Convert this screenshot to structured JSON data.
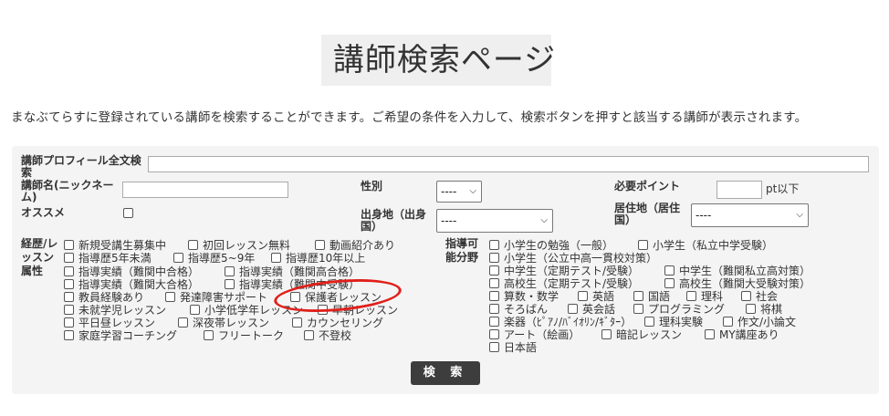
{
  "page": {
    "title": "講師検索ページ",
    "description": "まなぶてらすに登録されている講師を検索することができます。ご希望の条件を入力して、検索ボタンを押すと該当する講師が表示されます。"
  },
  "form": {
    "profile_label": "講師プロフィール全文検索",
    "name_label": "講師名(ニックネーム)",
    "recommend_label": "オススメ",
    "gender_label": "性別",
    "gender_value": "----",
    "points_label": "必要ポイント",
    "points_suffix": "pt以下",
    "birthplace_label": "出身地（出身国）",
    "birthplace_value": "----",
    "residence_label": "居住地（居住国）",
    "residence_value": "----",
    "career_label": "経歴/レッスン属性",
    "career_options": [
      "新規受講生募集中",
      "初回レッスン無料",
      "動画紹介あり",
      "指導歴5年未満",
      "指導歴5~9年",
      "指導歴10年以上",
      "指導実績（難関中合格）",
      "指導実績（難関高合格）",
      "指導実績（難関大合格）",
      "指導実績（難関中受験）",
      "教員経験あり",
      "発達障害サポート",
      "保護者レッスン",
      "未就学児レッスン",
      "小学低学年レッスン",
      "早朝レッスン",
      "平日昼レッスン",
      "深夜帯レッスン",
      "カウンセリング",
      "家庭学習コーチング",
      "フリートーク",
      "不登校"
    ],
    "field_label": "指導可能分野",
    "field_options": [
      "小学生の勉強（一般）",
      "小学生（私立中学受験）",
      "小学生（公立中高一貫校対策）",
      "中学生（定期テスト/受験）",
      "中学生（難関私立高対策）",
      "高校生（定期テスト/受験）",
      "高校生（難関大受験対策）",
      "算数・数学",
      "英語",
      "国語",
      "理科",
      "社会",
      "そろばん",
      "英会話",
      "プログラミング",
      "将棋",
      "楽器（ﾋﾟｱﾉ/ﾊﾞｲｵﾘﾝ/ｷﾞﾀｰ）",
      "理科実験",
      "作文/小論文",
      "アート（絵画）",
      "暗記レッスン",
      "MY講座あり",
      "日本語"
    ],
    "search_button": "検 索"
  },
  "annotation": {
    "color": "#e0201b"
  }
}
